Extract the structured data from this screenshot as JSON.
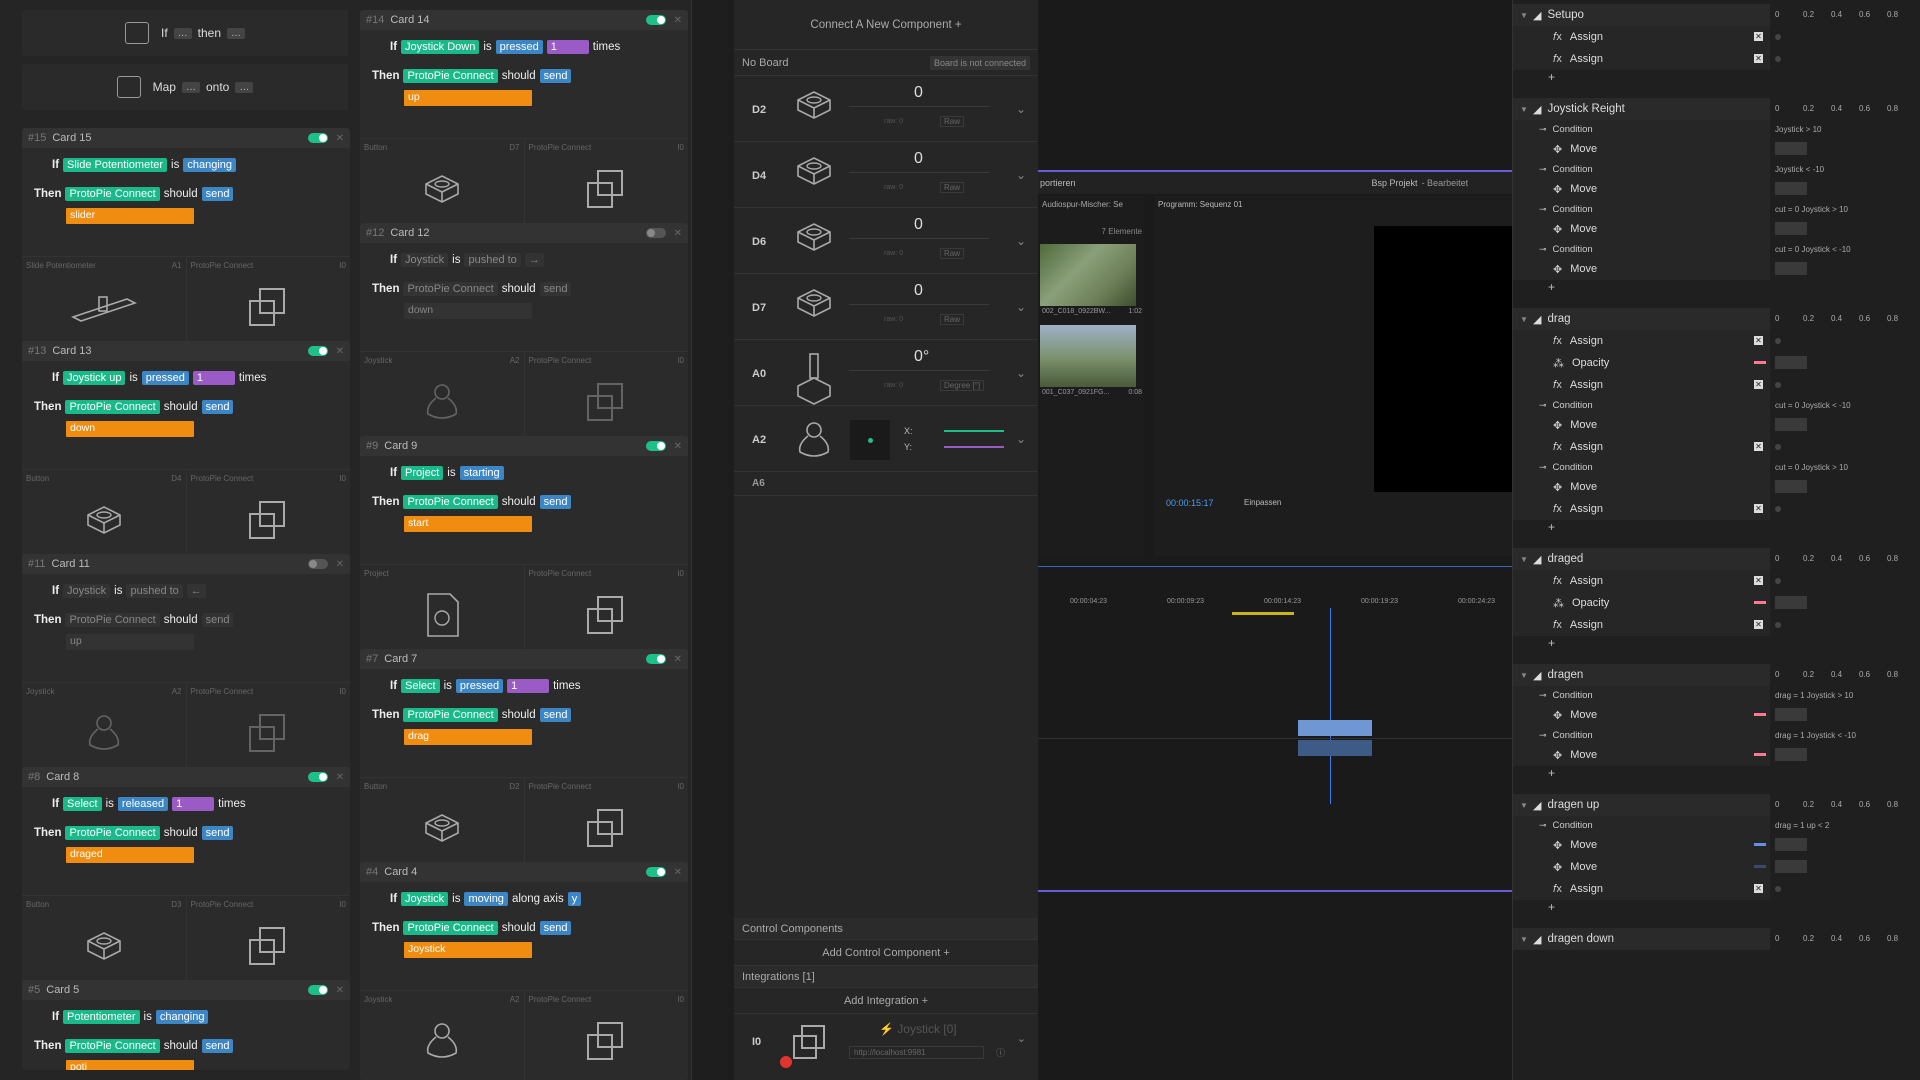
{
  "templates": {
    "if_then": {
      "pre": "If",
      "dots1": "…",
      "mid": "then",
      "dots2": "…"
    },
    "map_onto": {
      "pre": "Map",
      "dots1": "…",
      "mid": "onto",
      "dots2": "…"
    }
  },
  "cards_left": [
    {
      "num": "#15",
      "title": "Card 15",
      "active": true,
      "if_subject": "Slide Potentiometer",
      "is": "is",
      "action": "changing",
      "count": "",
      "times": "",
      "then_target": "ProtoPie Connect",
      "should": "should",
      "send": "send",
      "message": "slider",
      "foot_left": "Slide Potentiometer",
      "foot_left_pin": "A1",
      "foot_right": "ProtoPie Connect",
      "foot_right_pin": "I0"
    },
    {
      "num": "#13",
      "title": "Card 13",
      "active": true,
      "if_subject": "Joystick up",
      "is": "is",
      "action": "pressed",
      "count": "1",
      "times": "times",
      "then_target": "ProtoPie Connect",
      "should": "should",
      "send": "send",
      "message": "down",
      "foot_left": "Button",
      "foot_left_pin": "D4",
      "foot_right": "ProtoPie Connect",
      "foot_right_pin": "I0"
    },
    {
      "num": "#11",
      "title": "Card 11",
      "active": false,
      "if_subject": "Joystick",
      "is": "is",
      "action": "pushed to",
      "count": "←",
      "times": "",
      "then_target": "ProtoPie Connect",
      "should": "should",
      "send": "send",
      "message": "up",
      "foot_left": "Joystick",
      "foot_left_pin": "A2",
      "foot_right": "ProtoPie Connect",
      "foot_right_pin": "I0"
    },
    {
      "num": "#8",
      "title": "Card 8",
      "active": true,
      "if_subject": "Select",
      "is": "is",
      "action": "released",
      "count": "1",
      "times": "times",
      "then_target": "ProtoPie Connect",
      "should": "should",
      "send": "send",
      "message": "draged",
      "foot_left": "Button",
      "foot_left_pin": "D3",
      "foot_right": "ProtoPie Connect",
      "foot_right_pin": "I0"
    },
    {
      "num": "#5",
      "title": "Card 5",
      "active": true,
      "if_subject": "Potentiometer",
      "is": "is",
      "action": "changing",
      "count": "",
      "times": "",
      "then_target": "ProtoPie Connect",
      "should": "should",
      "send": "send",
      "message": "poti",
      "foot_left": "",
      "foot_left_pin": "",
      "foot_right": "",
      "foot_right_pin": ""
    }
  ],
  "cards_right": [
    {
      "num": "#14",
      "title": "Card 14",
      "active": true,
      "if_subject": "Joystick Down",
      "is": "is",
      "action": "pressed",
      "count": "1",
      "times": "times",
      "then_target": "ProtoPie Connect",
      "should": "should",
      "send": "send",
      "message": "up",
      "foot_left": "Button",
      "foot_left_pin": "D7",
      "foot_right": "ProtoPie Connect",
      "foot_right_pin": "I0"
    },
    {
      "num": "#12",
      "title": "Card 12",
      "active": false,
      "if_subject": "Joystick",
      "is": "is",
      "action": "pushed to",
      "count": "→",
      "times": "",
      "then_target": "ProtoPie Connect",
      "should": "should",
      "send": "send",
      "message": "down",
      "foot_left": "Joystick",
      "foot_left_pin": "A2",
      "foot_right": "ProtoPie Connect",
      "foot_right_pin": "I0"
    },
    {
      "num": "#9",
      "title": "Card 9",
      "active": true,
      "if_subject": "Project",
      "is": "is",
      "action": "starting",
      "count": "",
      "times": "",
      "then_target": "ProtoPie Connect",
      "should": "should",
      "send": "send",
      "message": "start",
      "foot_left": "Project",
      "foot_left_pin": "",
      "foot_right": "ProtoPie Connect",
      "foot_right_pin": "I0"
    },
    {
      "num": "#7",
      "title": "Card 7",
      "active": true,
      "if_subject": "Select",
      "is": "is",
      "action": "pressed",
      "count": "1",
      "times": "times",
      "then_target": "ProtoPie Connect",
      "should": "should",
      "send": "send",
      "message": "drag",
      "foot_left": "Button",
      "foot_left_pin": "D2",
      "foot_right": "ProtoPie Connect",
      "foot_right_pin": "I0"
    },
    {
      "num": "#4",
      "title": "Card 4",
      "active": true,
      "if_subject": "Joystick",
      "is": "is",
      "action": "moving",
      "count": "",
      "times": "",
      "axis_text": "along axis",
      "axis": "y",
      "then_target": "ProtoPie Connect",
      "should": "should",
      "send": "send",
      "message": "Joystick",
      "foot_left": "Joystick",
      "foot_left_pin": "A2",
      "foot_right": "ProtoPie Connect",
      "foot_right_pin": "I0"
    }
  ],
  "board": {
    "connect_label": "Connect A New Component +",
    "board_name": "No Board",
    "board_status": "Board is not connected",
    "components": [
      {
        "pin": "D2",
        "value": "0",
        "raw": "Raw",
        "rawl": "raw: 0"
      },
      {
        "pin": "D4",
        "value": "0",
        "raw": "Raw",
        "rawl": "raw: 0"
      },
      {
        "pin": "D6",
        "value": "0",
        "raw": "Raw",
        "rawl": "raw: 0"
      },
      {
        "pin": "D7",
        "value": "0",
        "raw": "Raw",
        "rawl": "raw: 0"
      },
      {
        "pin": "A0",
        "value": "0°",
        "raw": "Degree [°]",
        "rawl": "raw: 0"
      },
      {
        "pin": "A2",
        "value": "",
        "raw": "",
        "rawl": "",
        "x": "X:",
        "y": "Y:"
      }
    ],
    "a6": "A6",
    "control_components": "Control Components",
    "add_control": "Add Control Component +",
    "integrations": "Integrations [1]",
    "add_integration": "Add Integration +",
    "integration_pin": "I0",
    "integration_name": "⚡ Joystick [0]",
    "integration_url": "http://localhost:9981"
  },
  "premiere": {
    "tab_export": "portieren",
    "project_title": "Bsp Projekt",
    "project_state": "- Bearbeitet",
    "audio_mixer": "Audiospur-Mischer: Se",
    "program": "Programm: Sequenz 01",
    "elements": "7 Elemente",
    "clip1": "002_C018_0922BW...",
    "clip1_dur": "1:02",
    "clip2": "001_C037_0921FG...",
    "clip2_dur": "0:08",
    "timecode": "00:00:15:17",
    "fit": "Einpassen",
    "ticks": [
      "00:00:04:23",
      "00:00:09:23",
      "00:00:14:23",
      "00:00:19:23",
      "00:00:24:23"
    ]
  },
  "timeline": {
    "scale": [
      "0",
      "0.2",
      "0.4",
      "0.6",
      "0.8"
    ],
    "groups": [
      {
        "name": "Setupo",
        "rows": [
          {
            "t": "fx",
            "label": "Assign",
            "x": true
          },
          {
            "t": "fx",
            "label": "Assign",
            "x": true
          }
        ],
        "plus": true
      },
      {
        "name": "Joystick Reight",
        "rows": [
          {
            "t": "cond",
            "label": "Condition",
            "c": "Joystick > 10"
          },
          {
            "t": "mv",
            "label": "Move"
          },
          {
            "t": "cond",
            "label": "Condition",
            "c": "Joystick < -10"
          },
          {
            "t": "mv",
            "label": "Move"
          },
          {
            "t": "cond",
            "label": "Condition",
            "c": "cut = 0     Joystick > 10"
          },
          {
            "t": "mv",
            "label": "Move"
          },
          {
            "t": "cond",
            "label": "Condition",
            "c": "cut = 0     Joystick < -10"
          },
          {
            "t": "mv",
            "label": "Move"
          }
        ],
        "plus": true
      },
      {
        "name": "drag",
        "rows": [
          {
            "t": "fx",
            "label": "Assign",
            "x": true
          },
          {
            "t": "op",
            "label": "Opacity"
          },
          {
            "t": "fx",
            "label": "Assign",
            "x": true
          },
          {
            "t": "cond",
            "label": "Condition",
            "c": "cut = 0     Joystick < -10"
          },
          {
            "t": "mv",
            "label": "Move"
          },
          {
            "t": "fx",
            "label": "Assign",
            "x": true
          },
          {
            "t": "cond",
            "label": "Condition",
            "c": "cut = 0     Joystick > 10"
          },
          {
            "t": "mv",
            "label": "Move"
          },
          {
            "t": "fx",
            "label": "Assign",
            "x": true
          }
        ],
        "plus": true
      },
      {
        "name": "draged",
        "rows": [
          {
            "t": "fx",
            "label": "Assign",
            "x": true
          },
          {
            "t": "op",
            "label": "Opacity"
          },
          {
            "t": "fx",
            "label": "Assign",
            "x": true
          }
        ],
        "plus": true
      },
      {
        "name": "dragen",
        "rows": [
          {
            "t": "cond",
            "label": "Condition",
            "c": "drag = 1     Joystick > 10"
          },
          {
            "t": "mv",
            "label": "Move",
            "strip": "#ff7a8a"
          },
          {
            "t": "cond",
            "label": "Condition",
            "c": "drag = 1     Joystick < -10"
          },
          {
            "t": "mv",
            "label": "Move",
            "strip": "#ff7a8a"
          }
        ],
        "plus": true
      },
      {
        "name": "dragen up",
        "rows": [
          {
            "t": "cond",
            "label": "Condition",
            "c": "drag = 1     up < 2"
          },
          {
            "t": "mv",
            "label": "Move",
            "strip": "#6a8ee8"
          },
          {
            "t": "mv",
            "label": "Move",
            "strip": "#3a4a6a"
          },
          {
            "t": "fx",
            "label": "Assign",
            "x": true
          }
        ],
        "plus": true
      },
      {
        "name": "dragen down",
        "rows": [],
        "plus": false
      }
    ]
  }
}
